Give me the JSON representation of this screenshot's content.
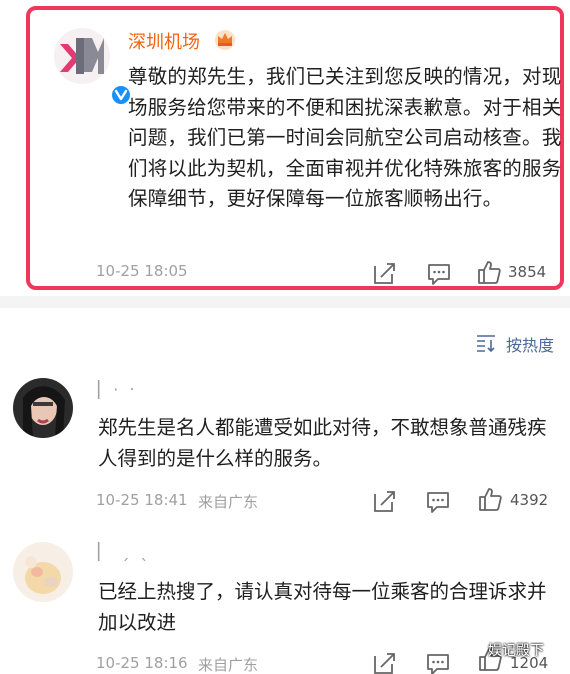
{
  "official_reply": {
    "author": "深圳机场",
    "body": "尊敬的郑先生，我们已关注到您反映的情况，对现场服务给您带来的不便和困扰深表歉意。对于相关问题，我们已第一时间会同航空公司启动核查。我们将以此为契机，全面审视并优化特殊旅客的服务保障细节，更好保障每一位旅客顺畅出行。",
    "time": "10-25 18:05",
    "likes": "3854",
    "highlight_color": "#f0365a"
  },
  "sort": {
    "label": "按热度"
  },
  "comments": [
    {
      "author": "▏· ‧",
      "body": "郑先生是名人都能遭受如此对待，不敢想象普通残疾人得到的是什么样的服务。",
      "time": "10-25 18:41",
      "location": "来自广东",
      "likes": "4392"
    },
    {
      "author": "▏  ˏ ˎ",
      "body": "已经上热搜了，请认真对待每一位乘客的合理诉求并加以改进",
      "time": "10-25 18:16",
      "location": "来自广东",
      "likes": "1204"
    }
  ],
  "watermark": "娱记殿下",
  "icons": [
    "share-icon",
    "comment-icon",
    "like-icon",
    "sort-icon",
    "verified-icon",
    "crown-icon"
  ]
}
